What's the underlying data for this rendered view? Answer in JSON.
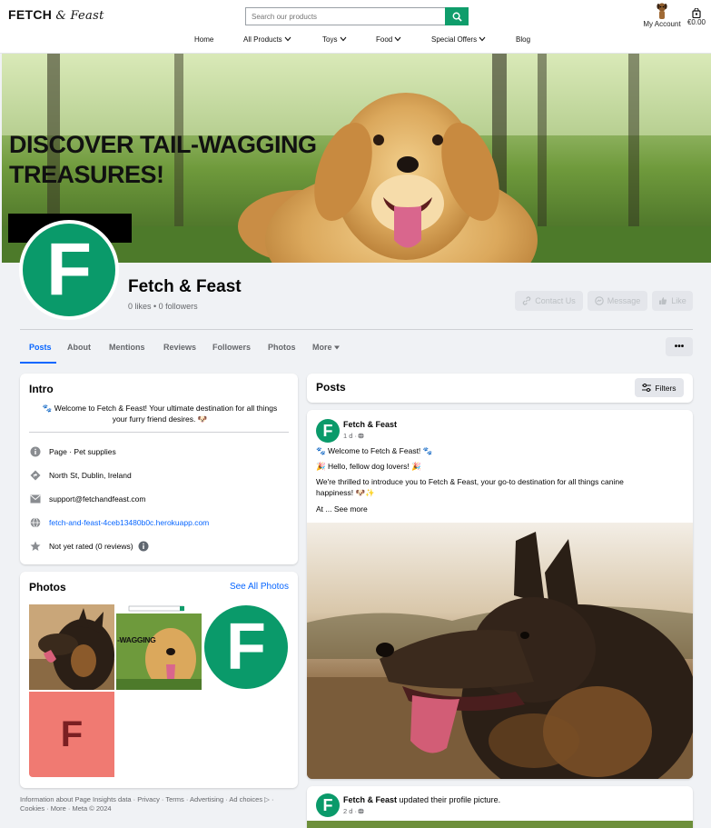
{
  "shop": {
    "brand_bold": "FETCH",
    "brand_amp": "&",
    "brand_script": "Feast",
    "search_placeholder": "Search our products",
    "account_label": "My Account",
    "cart_total": "€0.00",
    "nav": [
      "Home",
      "All Products",
      "Toys",
      "Food",
      "Special Offers",
      "Blog"
    ]
  },
  "cover": {
    "headline_line1": "DISCOVER TAIL-WAGGING",
    "headline_line2": "TREASURES!"
  },
  "page": {
    "name": "Fetch & Feast",
    "stats": "0 likes • 0 followers",
    "avatar_letter": "F",
    "actions": [
      "Contact Us",
      "Message",
      "Like"
    ],
    "tabs": [
      "Posts",
      "About",
      "Mentions",
      "Reviews",
      "Followers",
      "Photos",
      "More"
    ],
    "active_tab": "Posts",
    "more_button": "•••"
  },
  "intro": {
    "title": "Intro",
    "bio": "🐾 Welcome to Fetch & Feast! Your ultimate destination for all things your furry friend desires. 🐶",
    "category": "Page · Pet supplies",
    "address": "North St, Dublin, Ireland",
    "email": "support@fetchandfeast.com",
    "website": "fetch-and-feast-4ceb13480b0c.herokuapp.com",
    "rating": "Not yet rated (0 reviews)"
  },
  "photos": {
    "title": "Photos",
    "see_all": "See All Photos",
    "thumb_cover_text": "-WAGGING",
    "tile_letter": "F"
  },
  "footer": {
    "line1": "Information about Page Insights data · Privacy · Terms · Advertising · Ad choices ▷ ·",
    "line2": "Cookies · More · Meta © 2024"
  },
  "posts": {
    "title": "Posts",
    "filters_label": "Filters",
    "post1": {
      "author": "Fetch & Feast",
      "meta": "1 d · ",
      "line1": "🐾 Welcome to Fetch & Feast! 🐾",
      "line2": "🎉 Hello, fellow dog lovers! 🎉",
      "line3a": "We're thrilled to introduce you to Fetch & Feast, your go-to destination for all things canine",
      "line3b": "happiness! 🐶✨",
      "line4": "At ... See more"
    },
    "post2": {
      "author": "Fetch & Feast",
      "action": " updated their profile picture.",
      "meta": "2 d · "
    }
  },
  "colors": {
    "brand_green": "#0a9a6a",
    "fb_blue": "#0866ff",
    "tile_pink": "#f07a72",
    "tile_letter": "#7a1f22"
  }
}
